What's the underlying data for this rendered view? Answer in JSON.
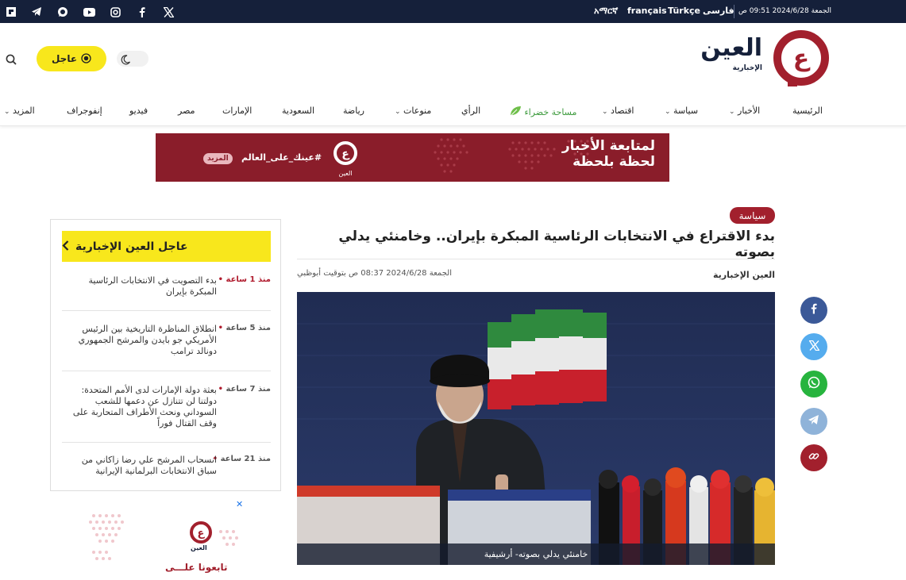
{
  "topbar": {
    "date": "الجمعة 2024/6/28 09:51 ص",
    "languages": [
      "فارسى",
      "Türkçe",
      "français",
      "አማርኛ"
    ]
  },
  "social_icons": [
    "x-icon",
    "facebook-icon",
    "instagram-icon",
    "youtube-icon",
    "whatsapp-icon",
    "telegram-icon",
    "flipboard-icon"
  ],
  "header": {
    "logo_text": "العين",
    "logo_sub": "الإخبارية",
    "urgent_label": "عاجل"
  },
  "nav": {
    "items": [
      {
        "label": "الرئيسية",
        "dropdown": false
      },
      {
        "label": "الأخبار",
        "dropdown": true
      },
      {
        "label": "سياسة",
        "dropdown": true
      },
      {
        "label": "اقتصاد",
        "dropdown": true
      },
      {
        "label": "مساحة خضراء",
        "dropdown": false
      },
      {
        "label": "الرأي",
        "dropdown": false
      },
      {
        "label": "منوعات",
        "dropdown": true
      },
      {
        "label": "رياضة",
        "dropdown": false
      },
      {
        "label": "السعودية",
        "dropdown": false
      },
      {
        "label": "الإمارات",
        "dropdown": false
      },
      {
        "label": "مصر",
        "dropdown": false
      },
      {
        "label": "فيديو",
        "dropdown": false
      },
      {
        "label": "إنفوجراف",
        "dropdown": false
      },
      {
        "label": "المزيد",
        "dropdown": true
      }
    ]
  },
  "banner": {
    "line1": "لمتابعة الأخبار",
    "line2": "لحظة بلحظة",
    "hashtag": "#عينك_على_العالم",
    "more": "المزيد",
    "logo_sub": "العين"
  },
  "sidebar": {
    "title": "عاجل العين الإخبارية",
    "items": [
      {
        "time": "منذ 1 ساعة",
        "text": "بدء التصويت في الانتخابات الرئاسية المبكرة بإيران"
      },
      {
        "time": "منذ 5 ساعة",
        "text": "انطلاق المناظرة التاريخية بين الرئيس الأمريكي جو بايدن والمرشح الجمهوري دونالد ترامب"
      },
      {
        "time": "منذ 7 ساعة",
        "text": "بعثة دولة الإمارات لدى الأمم المتحدة: دولتنا لن تتنازل عن دعمها للشعب السوداني ونحث الأطراف المتحاربة على وقف القتال فوراً"
      },
      {
        "time": "منذ 21 ساعة",
        "text": "انسحاب المرشح علي رضا زاكاني من سباق الانتخابات البرلمانية الإيرانية"
      }
    ]
  },
  "article": {
    "category": "سياسة",
    "headline": "بدء الاقتراع في الانتخابات الرئاسية المبكرة بإيران.. وخامنئي يدلي بصوته",
    "author": "العين الإخبارية",
    "date": "الجمعة 2024/6/28 08:37 ص بتوقيت أبوظبي",
    "caption": "خامنئي يدلي بصوته- أرشيفية"
  },
  "share_icons": [
    "facebook-icon",
    "x-icon",
    "whatsapp-icon",
    "telegram-icon",
    "link-icon"
  ],
  "ad": {
    "text": "تابعونا علـــى",
    "logo_sub": "العين"
  },
  "colors": {
    "topbar": "#15203a",
    "brand_red": "#a2202d",
    "urgent_yellow": "#f8e71c",
    "green": "#3c9a3c"
  }
}
